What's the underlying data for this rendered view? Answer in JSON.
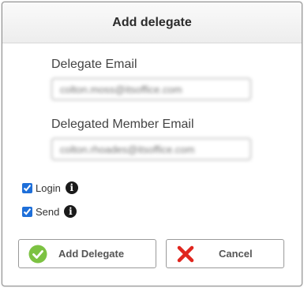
{
  "dialog": {
    "title": "Add delegate",
    "delegate_email": {
      "label": "Delegate Email",
      "value": "colton.moss@itsoffice.com"
    },
    "delegated_member_email": {
      "label": "Delegated Member Email",
      "value": "colton.rhoades@itsoffice.com"
    },
    "permissions": [
      {
        "label": "Login",
        "checked": true,
        "info_icon": "info-icon"
      },
      {
        "label": "Send",
        "checked": true,
        "info_icon": "info-icon"
      }
    ],
    "buttons": {
      "add_label": "Add Delegate",
      "add_icon": "check-circle-icon",
      "cancel_label": "Cancel",
      "cancel_icon": "close-icon"
    },
    "colors": {
      "accent_green": "#7cc242",
      "cancel_red": "#e0261e",
      "checkbox_blue": "#1e6fd9"
    }
  }
}
